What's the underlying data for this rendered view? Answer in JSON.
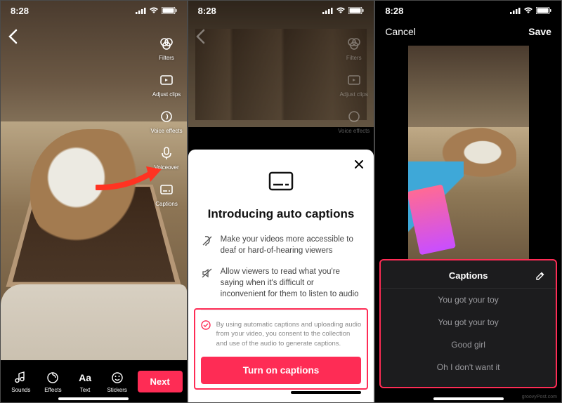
{
  "status": {
    "time": "8:28"
  },
  "screen1": {
    "right_tools": [
      {
        "name": "filters-tool",
        "label": "Filters"
      },
      {
        "name": "adjust-clips-tool",
        "label": "Adjust clips"
      },
      {
        "name": "voice-effects-tool",
        "label": "Voice effects"
      },
      {
        "name": "voiceover-tool",
        "label": "Voiceover"
      },
      {
        "name": "captions-tool",
        "label": "Captions"
      }
    ],
    "bottom_tools": [
      {
        "name": "sounds-tool",
        "label": "Sounds"
      },
      {
        "name": "effects-tool",
        "label": "Effects"
      },
      {
        "name": "text-tool",
        "label": "Text"
      },
      {
        "name": "stickers-tool",
        "label": "Stickers"
      }
    ],
    "next": "Next"
  },
  "screen2": {
    "title": "Introducing auto captions",
    "bullet1": "Make your videos more accessible to deaf or hard-of-hearing viewers",
    "bullet2": "Allow viewers to read what you're saying when it's difficult or inconvenient for them to listen to audio",
    "consent": "By using automatic captions and uploading audio from your video, you consent to the collection and use of the audio to generate captions.",
    "cta": "Turn on captions"
  },
  "screen3": {
    "cancel": "Cancel",
    "save": "Save",
    "panel_title": "Captions",
    "lines": [
      "You got your toy",
      "You got your toy",
      "Good girl",
      "Oh I don't want it"
    ]
  },
  "watermark": "groovyPost.com"
}
